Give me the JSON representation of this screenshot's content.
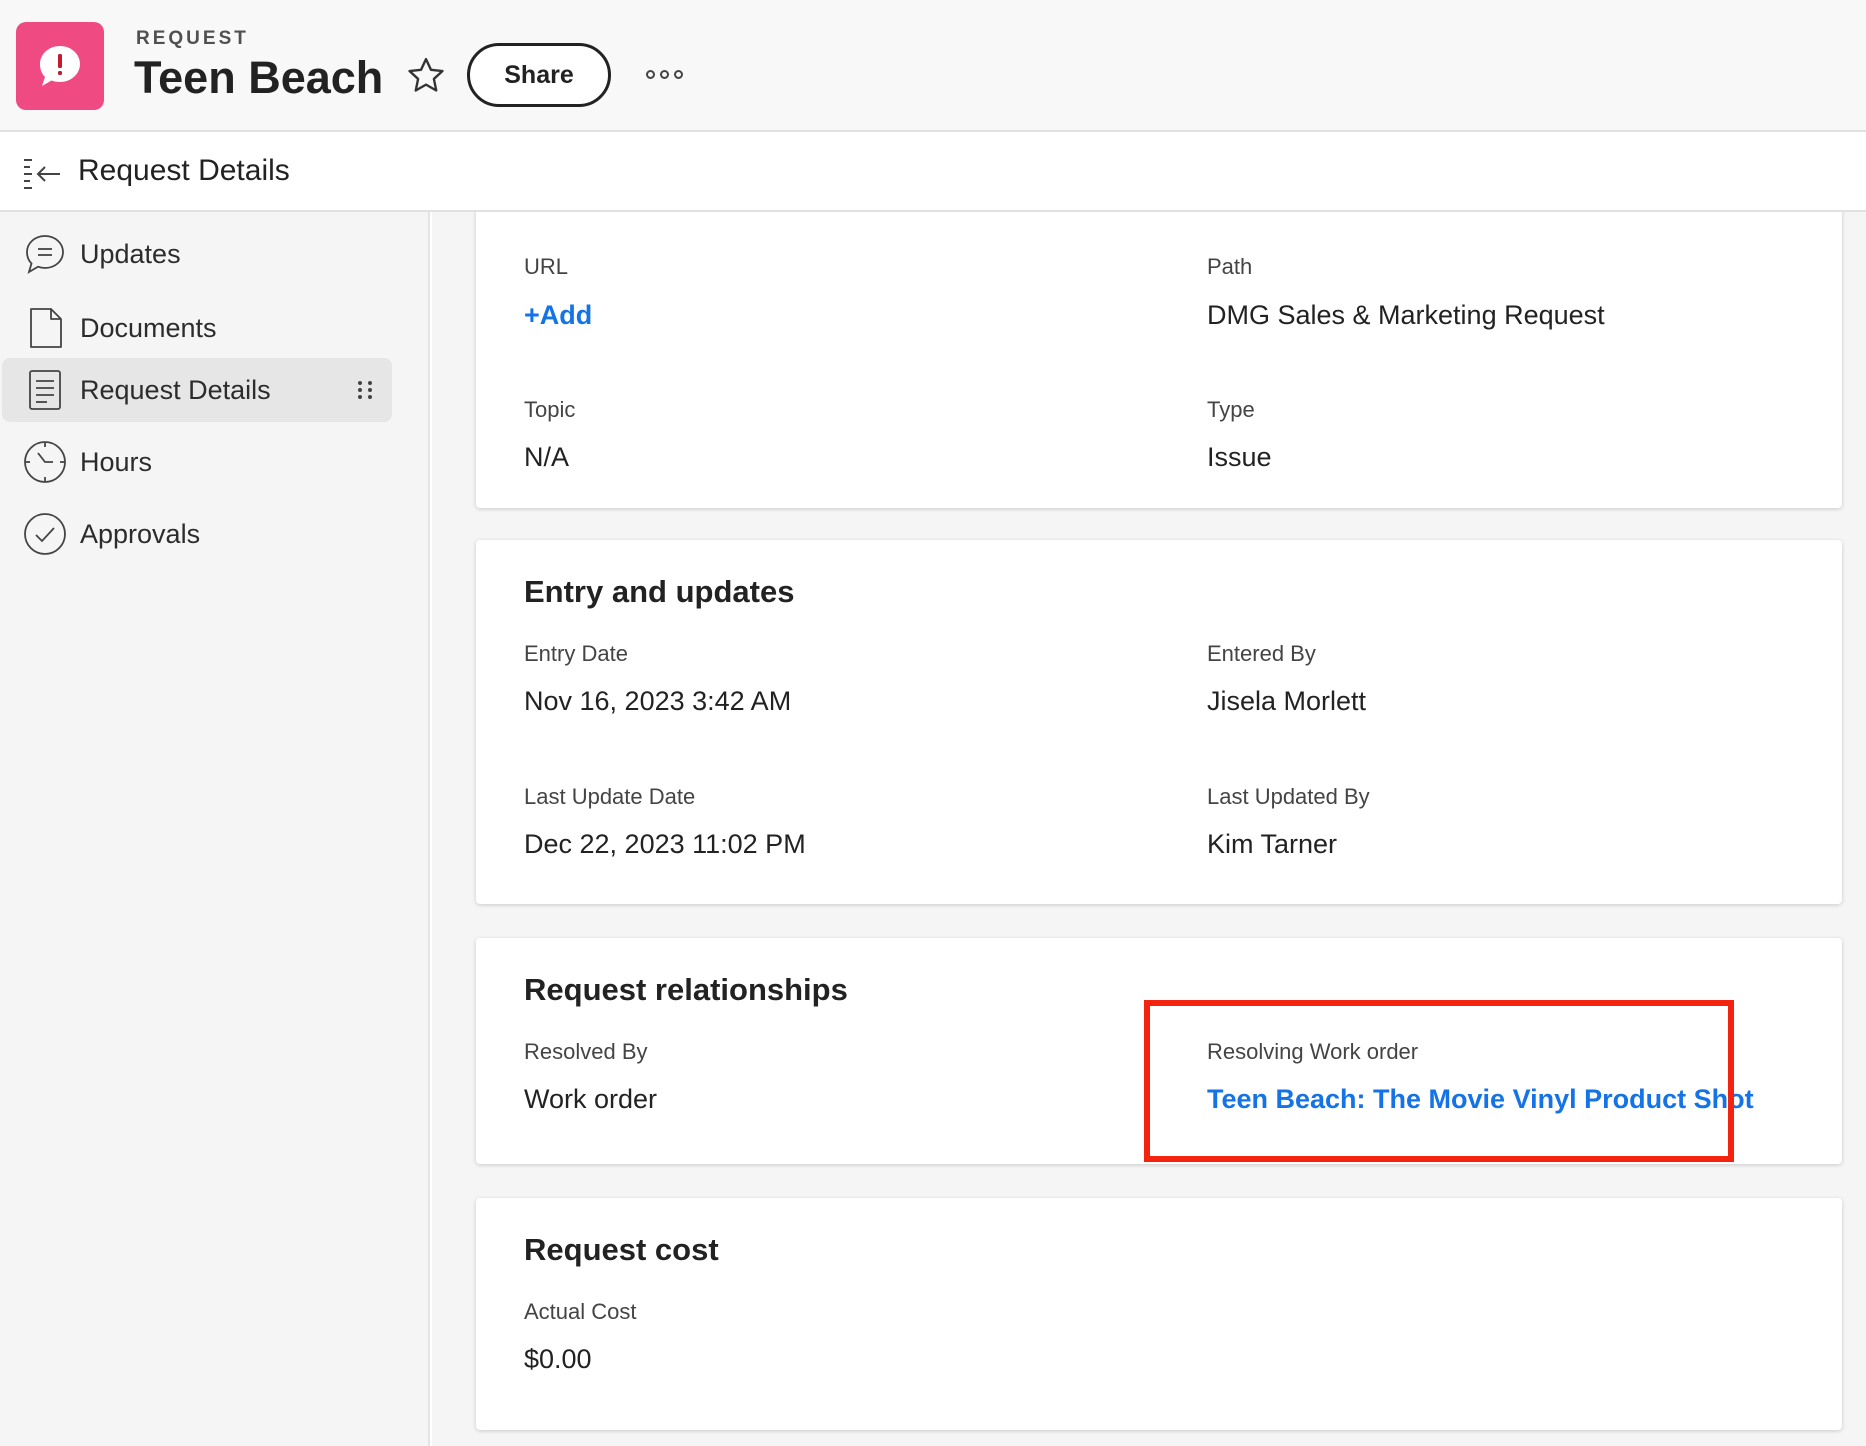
{
  "header": {
    "kicker": "REQUEST",
    "title": "Teen Beach",
    "share_label": "Share",
    "app_icon": "request-issue-icon",
    "brand_color": "#ef4b82"
  },
  "subheader": {
    "title": "Request Details"
  },
  "sidebar": {
    "items": [
      {
        "label": "Updates",
        "icon": "comment-icon",
        "active": false
      },
      {
        "label": "Documents",
        "icon": "document-icon",
        "active": false
      },
      {
        "label": "Request Details",
        "icon": "details-icon",
        "active": true
      },
      {
        "label": "Hours",
        "icon": "clock-icon",
        "active": false
      },
      {
        "label": "Approvals",
        "icon": "check-circle-icon",
        "active": false
      }
    ]
  },
  "overview": {
    "url_label": "URL",
    "url_add": "+Add",
    "path_label": "Path",
    "path_value": "DMG Sales & Marketing Request",
    "topic_label": "Topic",
    "topic_value": "N/A",
    "type_label": "Type",
    "type_value": "Issue"
  },
  "entry": {
    "title": "Entry and updates",
    "entry_date_label": "Entry Date",
    "entry_date_value": "Nov 16, 2023 3:42 AM",
    "entered_by_label": "Entered By",
    "entered_by_value": "Jisela Morlett",
    "last_update_label": "Last Update Date",
    "last_update_value": "Dec 22, 2023 11:02 PM",
    "last_updated_by_label": "Last Updated By",
    "last_updated_by_value": "Kim Tarner"
  },
  "relationships": {
    "title": "Request relationships",
    "resolved_by_label": "Resolved By",
    "resolved_by_value": "Work order",
    "resolving_label": "Resolving Work order",
    "resolving_value": "Teen Beach: The Movie Vinyl Product Shot",
    "highlight_color": "#f3230f"
  },
  "cost": {
    "title": "Request cost",
    "actual_cost_label": "Actual Cost",
    "actual_cost_value": "$0.00"
  },
  "colors": {
    "link": "#1473e6"
  }
}
